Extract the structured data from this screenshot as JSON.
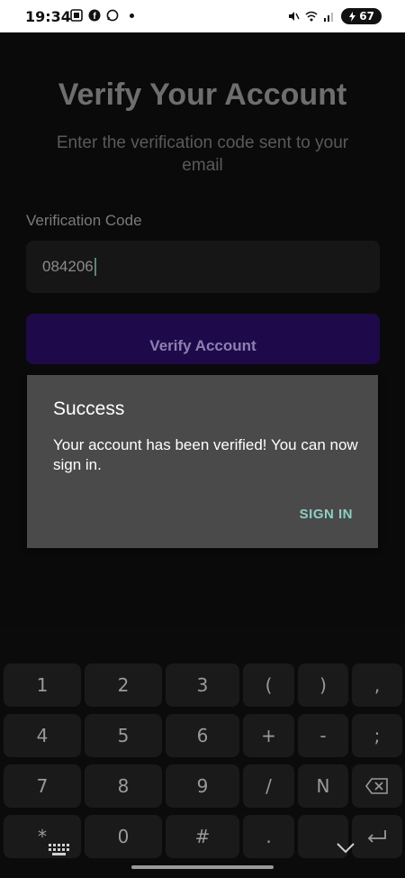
{
  "status_bar": {
    "time": "19:34",
    "battery": "67",
    "left_icons": [
      "screenshot-icon",
      "facebook-icon",
      "whatsapp-icon",
      "notification-dot-icon"
    ],
    "right_icons": [
      "mute-icon",
      "wifi-icon",
      "signal-icon",
      "battery-icon"
    ]
  },
  "page": {
    "title": "Verify Your Account",
    "subtitle": "Enter the verification code sent to your email",
    "field_label": "Verification Code",
    "code_value": "084206",
    "verify_button": "Verify Account"
  },
  "dialog": {
    "title": "Success",
    "message": "Your account has been verified! You can now sign in.",
    "action": "SIGN IN"
  },
  "keyboard": {
    "rows": [
      [
        "1",
        "2",
        "3",
        "(",
        ")",
        ","
      ],
      [
        "4",
        "5",
        "6",
        "+",
        "-",
        ";"
      ],
      [
        "7",
        "8",
        "9",
        "/",
        "N",
        "⌫"
      ],
      [
        "*",
        "0",
        "#",
        ".",
        "",
        "↵"
      ]
    ]
  },
  "colors": {
    "accent": "#8ccfc4",
    "dialog_bg": "#4a4a4a",
    "button_bg": "#1e0a4a"
  }
}
